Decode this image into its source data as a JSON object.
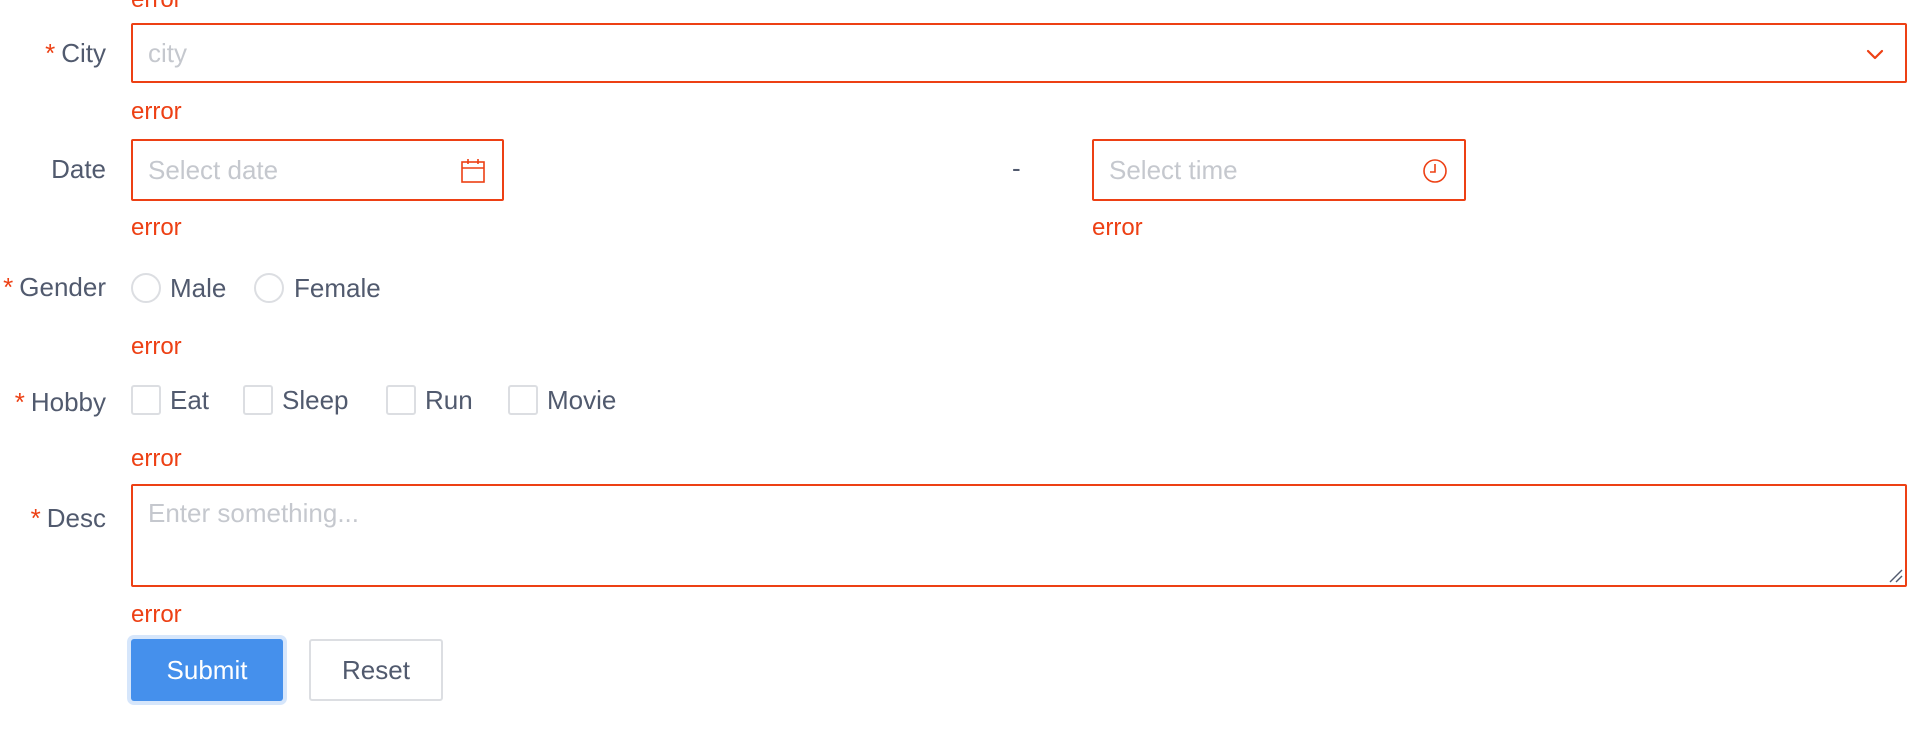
{
  "form": {
    "top_error": "error",
    "city": {
      "label": "City",
      "required": "*",
      "placeholder": "city",
      "error": "error"
    },
    "date": {
      "label": "Date",
      "date_placeholder": "Select date",
      "separator": "-",
      "time_placeholder": "Select time",
      "date_error": "error",
      "time_error": "error"
    },
    "gender": {
      "label": "Gender",
      "required": "*",
      "options": [
        "Male",
        "Female"
      ],
      "error": "error"
    },
    "hobby": {
      "label": "Hobby",
      "required": "*",
      "options": [
        "Eat",
        "Sleep",
        "Run",
        "Movie"
      ],
      "error": "error"
    },
    "desc": {
      "label": "Desc",
      "required": "*",
      "placeholder": "Enter something...",
      "error": "error"
    },
    "buttons": {
      "submit": "Submit",
      "reset": "Reset"
    }
  },
  "colors": {
    "error": "#ed4014",
    "primary": "#4590ec",
    "text": "#515a6e",
    "placeholder": "#c5c8ce",
    "border": "#dcdee2"
  }
}
